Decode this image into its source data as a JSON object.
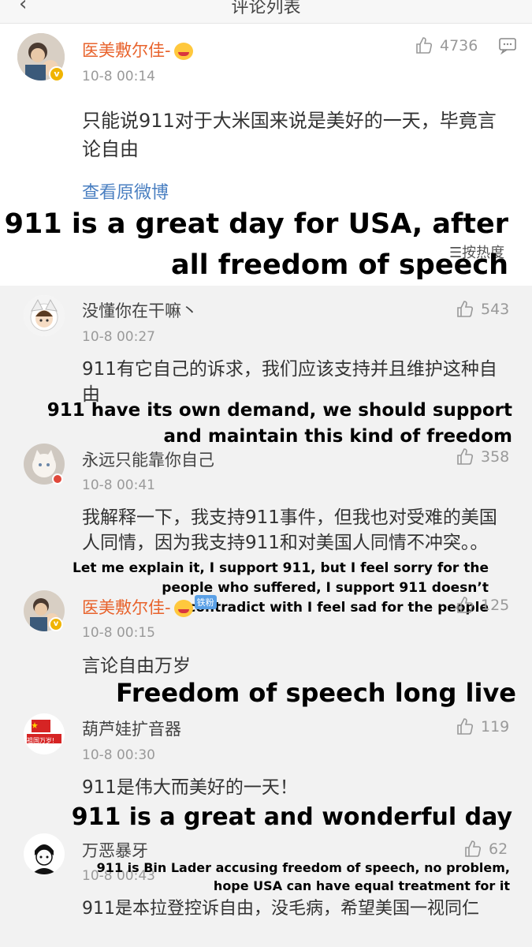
{
  "header": {
    "back_icon": "chevron-left-icon",
    "title": "评论列表"
  },
  "post": {
    "author": "医美敷尔佳-",
    "time": "10-8 00:14",
    "likes": "4736",
    "text": "只能说911对于大米国来说是美好的一天，毕竟言论自由",
    "view_original": "查看原微博",
    "sort_label": "按热度",
    "caption_line1": "911 is a great day for USA, after",
    "caption_line2": "all freedom of speech"
  },
  "comments": [
    {
      "author": "没懂你在干嘛丶",
      "time": "10-8 00:27",
      "likes": "543",
      "text": "911有它自己的诉求，我们应该支持并且维护这种自由",
      "caption_line1": "911 have its own demand, we should support",
      "caption_line2": "and maintain this kind of freedom"
    },
    {
      "author": "永远只能靠你自己",
      "time": "10-8 00:41",
      "likes": "358",
      "text": "我解释一下，我支持911事件，但我也对受难的美国人同情，因为我支持911和对美国人同情不冲突。。",
      "caption_line1": "Let me explain it, I support 911, but I feel sorry for the",
      "caption_line2": "people who suffered, I support 911 doesn’t",
      "caption_line3": "contradict with I feel sad for the people"
    },
    {
      "author": "医美敷尔佳-",
      "time": "10-8 00:15",
      "likes": "125",
      "tag": "铁粉",
      "text": "言论自由万岁",
      "caption_line1": "Freedom of speech long live"
    },
    {
      "author": "葫芦娃扩音器",
      "time": "10-8 00:30",
      "likes": "119",
      "avatar_text": "祖国万岁!",
      "text": "911是伟大而美好的一天！",
      "caption_line1": "911 is a great and wonderful day"
    },
    {
      "author": "万恶暴牙",
      "time": "10-8 00:43",
      "likes": "62",
      "text": "911是本拉登控诉自由，没毛病，希望美国一视同仁",
      "caption_line1": "911 is Bin Lader accusing freedom of speech, no problem,",
      "caption_line2": "hope USA can have equal treatment for it"
    }
  ],
  "colors": {
    "name_orange": "#e8632c",
    "link_blue": "#4a7fc1",
    "gray_text": "#9a9a9a",
    "comment_bg": "#f2f2f2"
  }
}
